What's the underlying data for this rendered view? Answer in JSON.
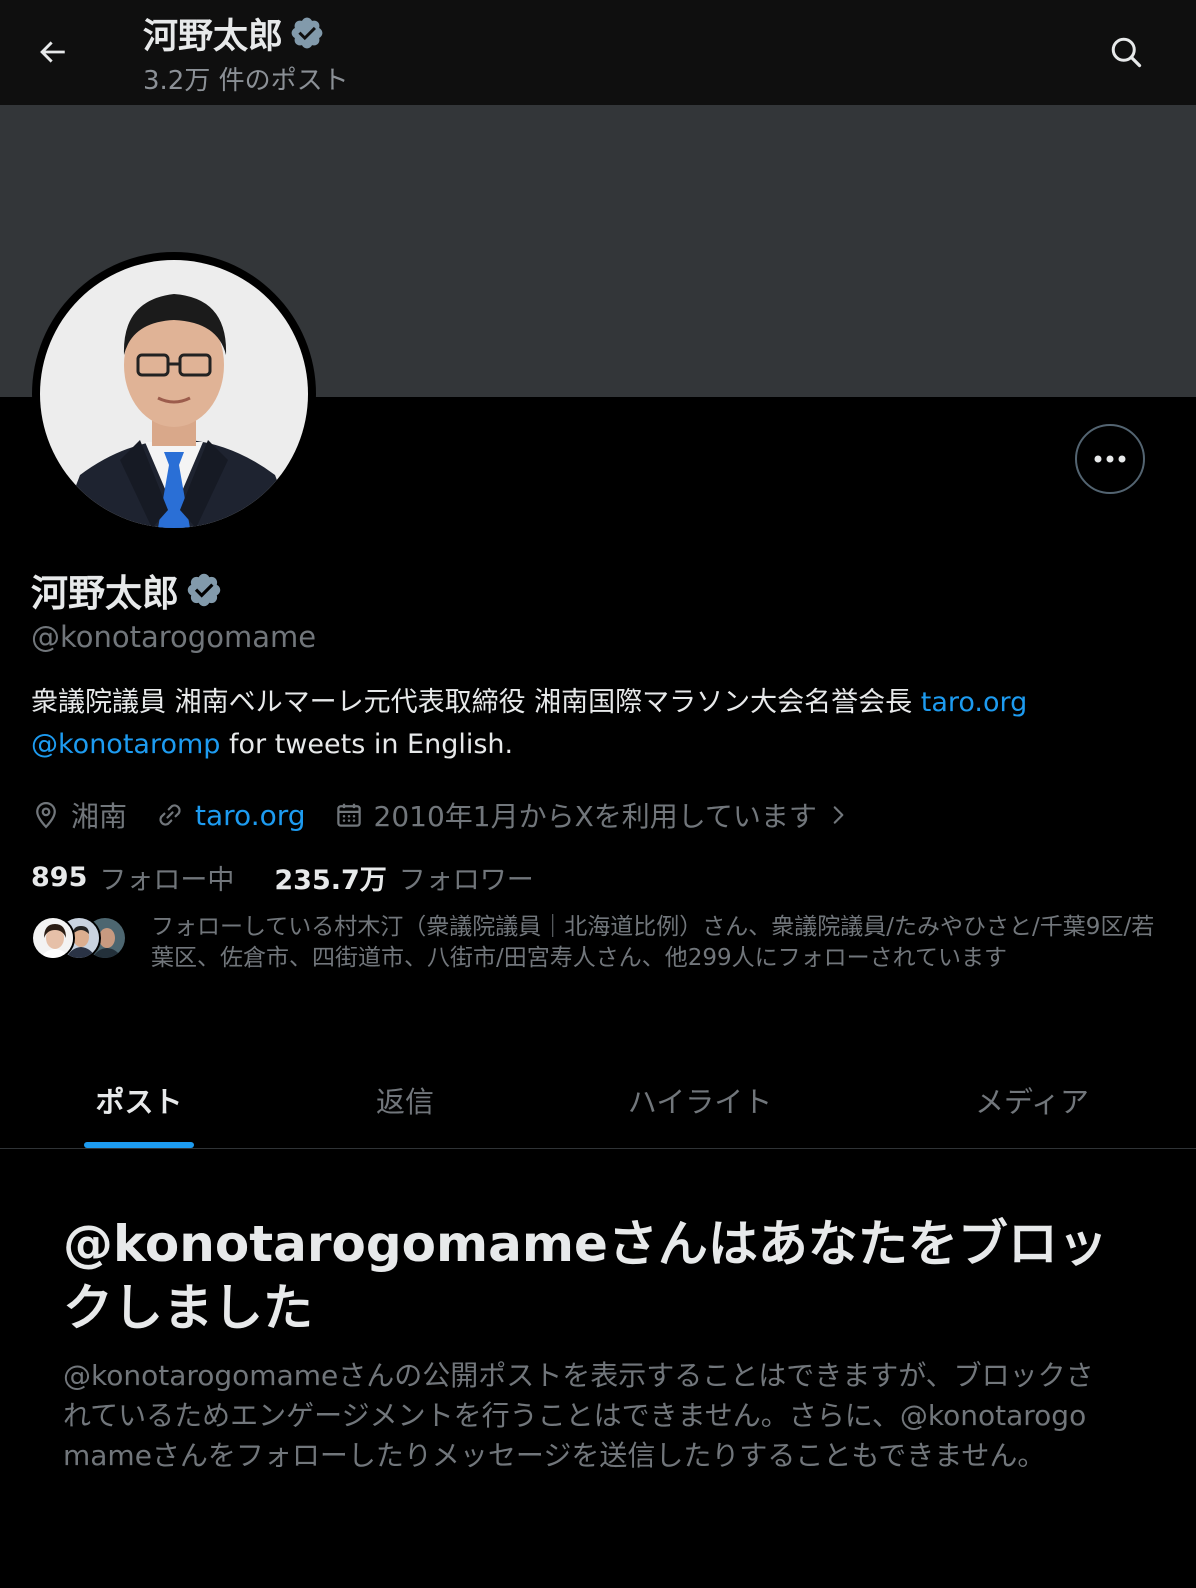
{
  "header": {
    "name": "河野太郎",
    "post_count": "3.2万 件のポスト"
  },
  "profile": {
    "display_name": "河野太郎",
    "handle": "@konotarogomame",
    "bio_text_1": "衆議院議員 湘南ベルマーレ元代表取締役 湘南国際マラソン大会名誉会長 ",
    "bio_link_1": "taro.org",
    "bio_mention": "@konotaromp",
    "bio_text_2": " for tweets in English.",
    "location": "湘南",
    "website": "taro.org",
    "joined": "2010年1月からXを利用しています",
    "following_count": "895",
    "following_label": "フォロー中",
    "followers_count": "235.7万",
    "followers_label": "フォロワー",
    "followers_you_know": "フォローしている村木汀（衆議院議員｜北海道比例）さん、衆議院議員/たみやひさと/千葉9区/若葉区、佐倉市、四街道市、八街市/田宮寿人さん、他299人にフォローされています"
  },
  "tabs": [
    {
      "label": "ポスト",
      "active": true
    },
    {
      "label": "返信",
      "active": false
    },
    {
      "label": "ハイライト",
      "active": false
    },
    {
      "label": "メディア",
      "active": false
    }
  ],
  "blocked": {
    "title": "@konotarogomameさんはあなたをブロックしました",
    "description": "@konotarogomameさんの公開ポストを表示することはできますが、ブロックされているためエンゲージメントを行うことはできません。さらに、@konotarogomameさんをフォローしたりメッセージを送信したりすることもできません。"
  },
  "icons": {
    "back": "arrow-left-icon",
    "search": "search-icon",
    "verified": "verified-badge-icon",
    "more": "more-horizontal-icon",
    "location": "location-pin-icon",
    "link": "link-icon",
    "calendar": "calendar-icon",
    "chevron": "chevron-right-icon"
  },
  "colors": {
    "background": "#000000",
    "banner": "#333639",
    "accent": "#1d9bf0",
    "secondary_text": "#71767b",
    "verified_badge": "#829aab"
  }
}
